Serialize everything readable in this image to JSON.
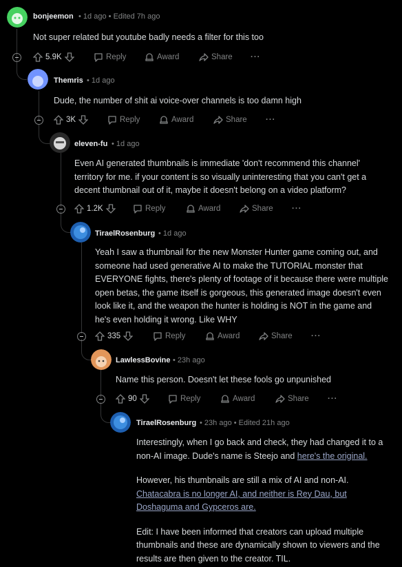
{
  "comments": [
    {
      "username": "bonjeemon",
      "time": "1d ago",
      "edited": "Edited 7h ago",
      "paragraphs": [
        [
          "Not super related but youtube badly needs a filter for this too"
        ]
      ],
      "votes": "5.9K",
      "avatar_color": "#46d160"
    },
    {
      "username": "Themris",
      "time": "1d ago",
      "edited": "",
      "paragraphs": [
        [
          "Dude, the number of shit ai voice-over channels is too damn high"
        ]
      ],
      "votes": "3K",
      "avatar_color": "#7193ff"
    },
    {
      "username": "eleven-fu",
      "time": "1d ago",
      "edited": "",
      "paragraphs": [
        [
          "Even AI generated thumbnails is immediate 'don't recommend this channel'",
          "territory for me. if your content is so visually uninteresting that you can't get a",
          "decent thumbnail out of it, maybe it doesn't belong on a video platform?"
        ]
      ],
      "votes": "1.2K",
      "avatar_color": "#d0d0d0"
    },
    {
      "username": "TiraelRosenburg",
      "time": "1d ago",
      "edited": "",
      "paragraphs": [
        [
          "Yeah I saw a thumbnail for the new Monster Hunter game coming out, and",
          "someone had used generative AI to make the TUTORIAL monster that",
          "EVERYONE fights, there's plenty of footage of it because there were multiple",
          "open betas, the game itself is gorgeous, this generated image doesn't even",
          "look like it, and the weapon the hunter is holding is NOT in the game and",
          "he's even holding it wrong. Like WHY"
        ]
      ],
      "votes": "335",
      "avatar_color": "#3d8ee0"
    },
    {
      "username": "LawlessBovine",
      "time": "23h ago",
      "edited": "",
      "paragraphs": [
        [
          "Name this person. Doesn't let these fools go unpunished"
        ]
      ],
      "votes": "90",
      "avatar_color": "#e3965a"
    },
    {
      "username": "TiraelRosenburg",
      "time": "23h ago",
      "edited": "Edited 21h ago",
      "paragraphs": [
        [
          "Interestingly, when I go back and check, they had changed it to a",
          "non-AI image. Dude's name is Steejo and "
        ],
        [
          "However, his thumbnails are still a mix of AI and non-AI.",
          ""
        ],
        [
          "Edit: I have been informed that creators can upload multiple",
          "thumbnails and these are dynamically shown to viewers and the",
          "results are then given to the creator. TIL."
        ]
      ],
      "votes": "",
      "avatar_color": "#3d8ee0"
    }
  ],
  "links": {
    "original": "here's the original.",
    "chatacabra_line1": "Chatacabra is no longer AI, and neither is Rey Dau, but",
    "chatacabra_line2": "Doshaguma and Gypceros are."
  },
  "actions": {
    "reply": "Reply",
    "award": "Award",
    "share": "Share",
    "more": "···"
  },
  "separator": "•"
}
